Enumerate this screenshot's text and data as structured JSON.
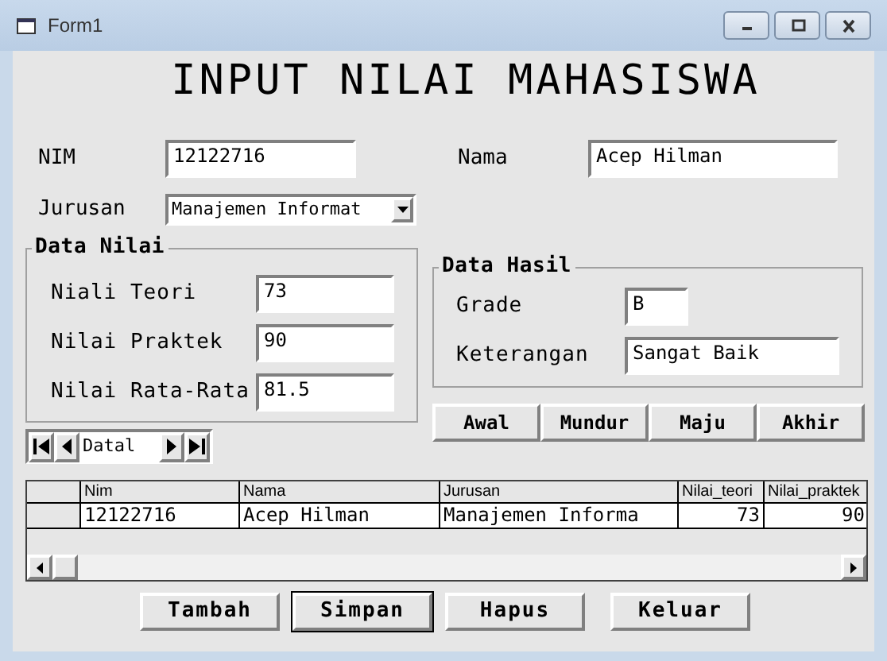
{
  "window": {
    "title": "Form1"
  },
  "heading": "INPUT NILAI MAHASISWA",
  "nim": {
    "label": "NIM",
    "value": "12122716"
  },
  "nama": {
    "label": "Nama",
    "value": "Acep Hilman"
  },
  "jurusan": {
    "label": "Jurusan",
    "value": "Manajemen Informat"
  },
  "data_nilai": {
    "title": "Data Nilai",
    "fields": [
      {
        "label": "Niali Teori",
        "value": "73"
      },
      {
        "label": "Nilai Praktek",
        "value": "90"
      },
      {
        "label": "Nilai Rata-Rata",
        "value": "81.5"
      }
    ]
  },
  "navigator": {
    "caption": "Datal"
  },
  "data_hasil": {
    "title": "Data Hasil",
    "fields": [
      {
        "kind": "short",
        "label": "Grade",
        "value": "B"
      },
      {
        "kind": "wide",
        "label": "Keterangan",
        "value": "Sangat Baik"
      }
    ]
  },
  "nav_buttons": [
    "Awal",
    "Mundur",
    "Maju",
    "Akhir"
  ],
  "grid": {
    "columns": [
      {
        "label": "Nim",
        "kind": "text"
      },
      {
        "label": "Nama",
        "kind": "text"
      },
      {
        "label": "Jurusan",
        "kind": "text"
      },
      {
        "label": "Nilai_teori",
        "kind": "number"
      },
      {
        "label": "Nilai_praktek",
        "kind": "number"
      }
    ],
    "rows": [
      {
        "cells": [
          "12122716",
          "Acep Hilman",
          "Manajemen Informa",
          "73",
          "90"
        ]
      }
    ]
  },
  "actions": [
    {
      "label": "Tambah",
      "focused": false
    },
    {
      "label": "Simpan",
      "focused": true
    },
    {
      "label": "Hapus",
      "focused": false
    },
    {
      "label": "Keluar",
      "focused": false
    }
  ]
}
